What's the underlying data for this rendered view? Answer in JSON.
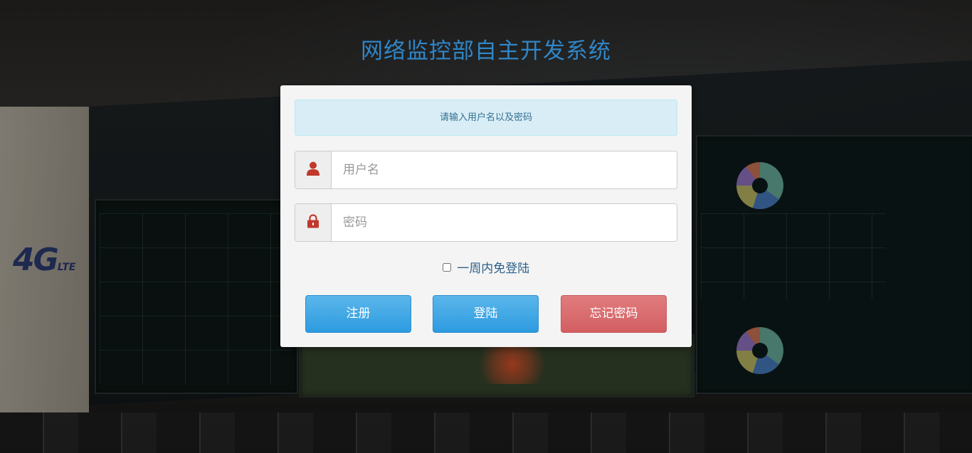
{
  "page": {
    "title": "网络监控部自主开发系统"
  },
  "login": {
    "alert_text": "请输入用户名以及密码",
    "username_placeholder": "用户名",
    "password_placeholder": "密码",
    "user_icon": "user-icon",
    "lock_icon": "lock-icon",
    "remember_label": "一周内免登陆",
    "remember_checked": false
  },
  "buttons": {
    "register": "注册",
    "login": "登陆",
    "forgot": "忘记密码"
  },
  "background": {
    "logo_text": "4G",
    "logo_small": "LTE"
  },
  "colors": {
    "title": "#2f86c8",
    "primary": "#2d9be0",
    "danger": "#d35f62",
    "icon": "#c0392b"
  }
}
